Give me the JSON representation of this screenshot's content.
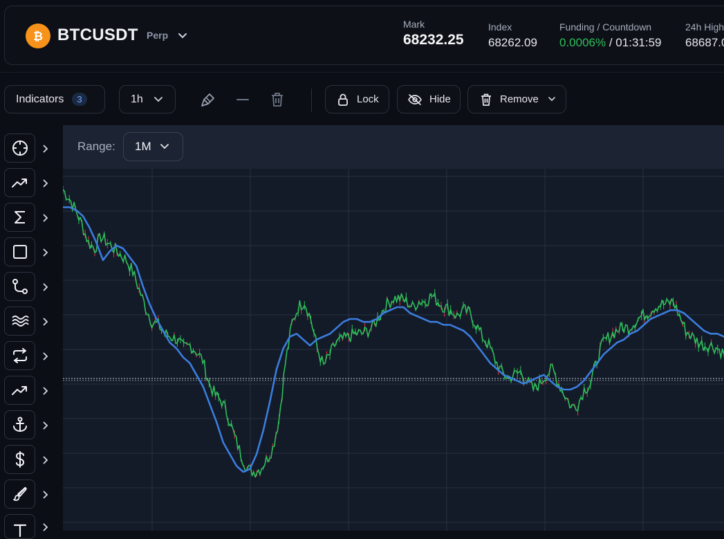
{
  "header": {
    "symbol": "BTCUSDT",
    "contract_type": "Perp",
    "stats": {
      "mark_label": "Mark",
      "mark_value": "68232.25",
      "index_label": "Index",
      "index_value": "68262.09",
      "funding_label": "Funding / Countdown",
      "funding_rate": "0.0006%",
      "countdown": "/ 01:31:59",
      "high_label": "24h High",
      "high_value": "68687.0"
    }
  },
  "toolbar": {
    "indicators_label": "Indicators",
    "indicators_count": "3",
    "interval": "1h",
    "lock_label": "Lock",
    "hide_label": "Hide",
    "remove_label": "Remove"
  },
  "sidebar": {
    "tools": [
      {
        "icon": "crosshair-icon"
      },
      {
        "icon": "trend-line-icon"
      },
      {
        "icon": "sigma-icon"
      },
      {
        "icon": "rectangle-icon"
      },
      {
        "icon": "path-icon"
      },
      {
        "icon": "waves-icon"
      },
      {
        "icon": "swap-icon"
      },
      {
        "icon": "trend-up-icon"
      },
      {
        "icon": "anchor-icon"
      },
      {
        "icon": "dollar-icon"
      },
      {
        "icon": "brush-icon"
      },
      {
        "icon": "text-icon"
      }
    ]
  },
  "chart": {
    "range_label": "Range:",
    "range_value": "1M"
  },
  "colors": {
    "background": "#0b0e14",
    "chart_background": "#131a28",
    "price_up": "#2fbf5b",
    "price_down": "#e0394a",
    "moving_average": "#3b7ddd",
    "bitcoin": "#f7931a"
  },
  "chart_data": {
    "type": "line",
    "series": [
      {
        "values": [
          100,
          97,
          93,
          88,
          82,
          80,
          84,
          82,
          80,
          78,
          76,
          72,
          66,
          60,
          55,
          54,
          51,
          50,
          49,
          46,
          47,
          45,
          42,
          34,
          30,
          28,
          23,
          16,
          10,
          5,
          4,
          5,
          8,
          12,
          22,
          41,
          54,
          60,
          62,
          56,
          46,
          40,
          44,
          48,
          49,
          50,
          51,
          51,
          52,
          54,
          58,
          61,
          63,
          63,
          62,
          60,
          62,
          62,
          64,
          62,
          60,
          59,
          57,
          59,
          58,
          54,
          50,
          47,
          42,
          38,
          36,
          37,
          38,
          35,
          32,
          34,
          37,
          39,
          34,
          30,
          26,
          27,
          32,
          34,
          42,
          48,
          50,
          52,
          53,
          53,
          55,
          57,
          58,
          60,
          61,
          61,
          62,
          57,
          52,
          50,
          48,
          47,
          47,
          46,
          44
        ]
      },
      {
        "values": [
          94,
          94,
          93,
          91,
          87,
          82,
          76,
          79,
          81,
          80,
          77,
          74,
          67,
          61,
          56,
          52,
          48,
          46,
          43,
          41,
          37,
          33,
          27,
          21,
          14,
          10,
          6,
          4,
          5,
          10,
          18,
          28,
          39,
          46,
          50,
          51,
          49,
          47,
          49,
          50,
          51,
          53,
          55,
          56,
          56,
          55,
          55,
          56,
          58,
          59,
          60,
          60,
          58,
          57,
          56,
          55,
          55,
          54,
          54,
          53,
          52,
          50,
          47,
          44,
          41,
          39,
          37,
          36,
          35,
          34,
          35,
          36,
          37,
          35,
          33,
          32,
          32,
          33,
          35,
          38,
          41,
          44,
          46,
          48,
          49,
          51,
          52,
          54,
          56,
          57,
          58,
          59,
          59,
          58,
          56,
          54,
          52,
          51,
          51,
          50
        ]
      }
    ]
  }
}
